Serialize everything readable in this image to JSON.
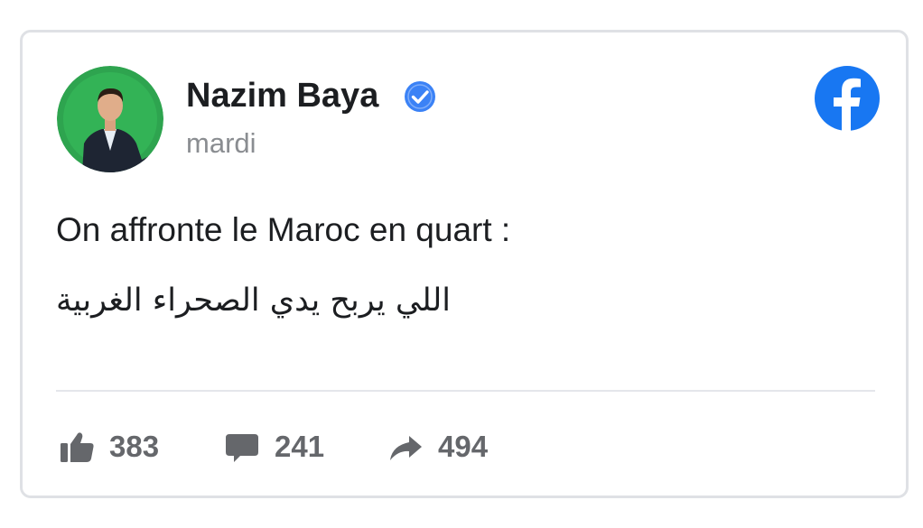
{
  "post": {
    "author": "Nazim Baya",
    "verified": true,
    "date": "mardi",
    "text_fr": "On affronte le Maroc en quart :",
    "text_ar": "اللي يربح يدي الصحراء الغربية"
  },
  "stats": {
    "likes": "383",
    "comments": "241",
    "shares": "494"
  },
  "icons": {
    "verified": "verified-badge-icon",
    "brand": "facebook-logo-icon",
    "likes": "thumbs-up-icon",
    "comments": "comment-bubble-icon",
    "shares": "share-arrow-icon"
  },
  "colors": {
    "brand_blue": "#1877f2",
    "verified_blue": "#3b82f6",
    "stat_gray": "#65676b",
    "avatar_bg": "#2ea44f"
  }
}
